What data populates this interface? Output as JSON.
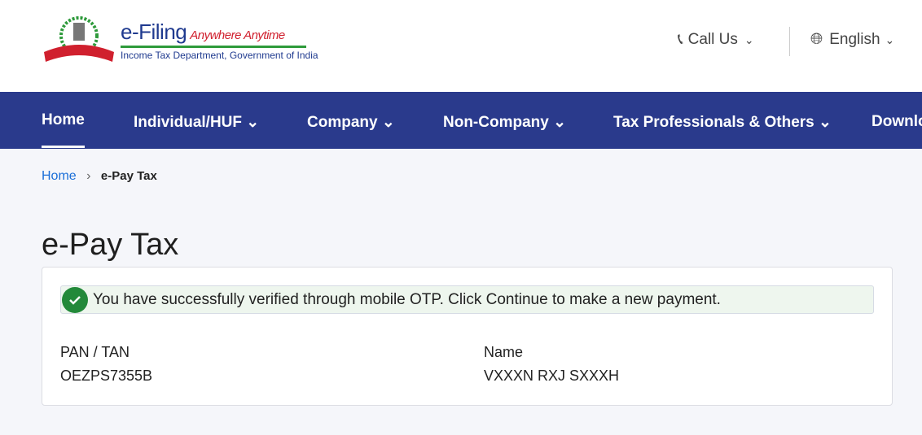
{
  "header": {
    "logo_text": "INCOME TAX DEPARTMENT",
    "brand": "e-Filing",
    "tagline": "Anywhere Anytime",
    "subtitle": "Income Tax Department, Government of India",
    "call_us": "Call Us",
    "language": "English"
  },
  "nav": {
    "items": [
      "Home",
      "Individual/HUF",
      "Company",
      "Non-Company",
      "Tax Professionals & Others",
      "Downloads"
    ]
  },
  "breadcrumb": {
    "home": "Home",
    "current": "e-Pay Tax"
  },
  "page": {
    "title": "e-Pay Tax",
    "alert": "You have successfully verified through mobile OTP. Click Continue to make a new payment.",
    "pan_label": "PAN / TAN",
    "pan_value": "OEZPS7355B",
    "name_label": "Name",
    "name_value": "VXXXN RXJ SXXXH"
  },
  "colors": {
    "nav": "#2a3a8c",
    "success": "#23893a",
    "link": "#1a6ed8"
  }
}
